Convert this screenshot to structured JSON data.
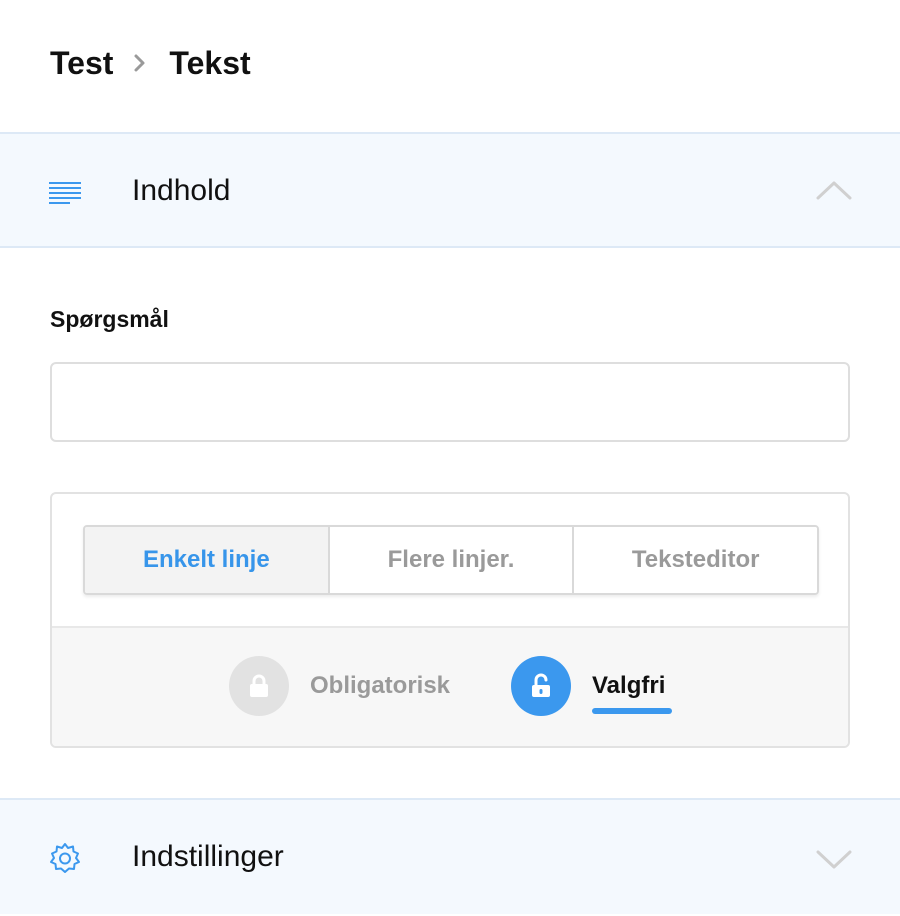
{
  "breadcrumb": {
    "parent": "Test",
    "current": "Tekst"
  },
  "sections": {
    "content": {
      "title": "Indhold",
      "icon": "text-lines-icon",
      "expanded": true
    },
    "settings": {
      "title": "Indstillinger",
      "icon": "gear-icon",
      "expanded": false
    }
  },
  "question": {
    "label": "Spørgsmål",
    "value": "",
    "placeholder": ""
  },
  "input_type": {
    "options": [
      "Enkelt linje",
      "Flere linjer.",
      "Teksteditor"
    ],
    "selected": "Enkelt linje"
  },
  "requirement": {
    "required_label": "Obligatorisk",
    "optional_label": "Valgfri",
    "selected": "Valgfri"
  },
  "colors": {
    "accent": "#3b98ee",
    "header_bg": "#f4f9fe",
    "muted_text": "#9a9a9a"
  }
}
